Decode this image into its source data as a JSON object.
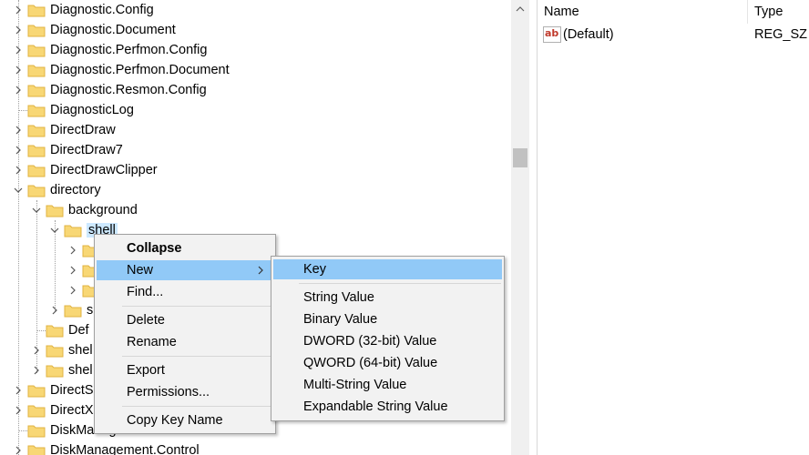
{
  "tree": {
    "items": [
      {
        "label": "Diagnostic.Config"
      },
      {
        "label": "Diagnostic.Document"
      },
      {
        "label": "Diagnostic.Perfmon.Config"
      },
      {
        "label": "Diagnostic.Perfmon.Document"
      },
      {
        "label": "Diagnostic.Resmon.Config"
      },
      {
        "label": "DiagnosticLog"
      },
      {
        "label": "DirectDraw"
      },
      {
        "label": "DirectDraw7"
      },
      {
        "label": "DirectDrawClipper"
      },
      {
        "label": "directory"
      },
      {
        "label": "background"
      },
      {
        "label": "shell"
      },
      {
        "label": "s"
      },
      {
        "label": "Def"
      },
      {
        "label": "shel"
      },
      {
        "label": "shel"
      },
      {
        "label": "DirectS"
      },
      {
        "label": "DirectX"
      },
      {
        "label": "DiskManagementConnection"
      },
      {
        "label": "DiskManagement.Control"
      }
    ]
  },
  "list": {
    "columns": {
      "name": "Name",
      "type": "Type"
    },
    "rows": [
      {
        "name": "(Default)",
        "type": "REG_SZ",
        "icon": "string-value-icon"
      }
    ]
  },
  "context_menu": {
    "items": {
      "collapse": "Collapse",
      "new": "New",
      "find": "Find...",
      "delete": "Delete",
      "rename": "Rename",
      "export": "Export",
      "permissions": "Permissions...",
      "copy_key_name": "Copy Key Name"
    }
  },
  "submenu": {
    "items": {
      "key": "Key",
      "string": "String Value",
      "binary": "Binary Value",
      "dword": "DWORD (32-bit) Value",
      "qword": "QWORD (64-bit) Value",
      "multi": "Multi-String Value",
      "expand": "Expandable String Value"
    }
  },
  "colors": {
    "highlight": "#91c9f7",
    "selection": "#cce8ff",
    "folder": "#f8d775"
  }
}
